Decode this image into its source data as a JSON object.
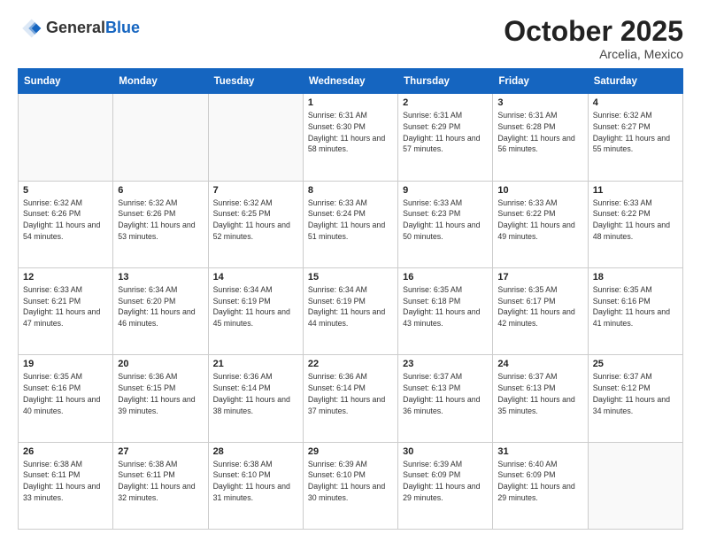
{
  "header": {
    "logo_general": "General",
    "logo_blue": "Blue",
    "month": "October 2025",
    "location": "Arcelia, Mexico"
  },
  "days_of_week": [
    "Sunday",
    "Monday",
    "Tuesday",
    "Wednesday",
    "Thursday",
    "Friday",
    "Saturday"
  ],
  "weeks": [
    [
      {
        "day": "",
        "sunrise": "",
        "sunset": "",
        "daylight": "",
        "empty": true
      },
      {
        "day": "",
        "sunrise": "",
        "sunset": "",
        "daylight": "",
        "empty": true
      },
      {
        "day": "",
        "sunrise": "",
        "sunset": "",
        "daylight": "",
        "empty": true
      },
      {
        "day": "1",
        "sunrise": "Sunrise: 6:31 AM",
        "sunset": "Sunset: 6:30 PM",
        "daylight": "Daylight: 11 hours and 58 minutes."
      },
      {
        "day": "2",
        "sunrise": "Sunrise: 6:31 AM",
        "sunset": "Sunset: 6:29 PM",
        "daylight": "Daylight: 11 hours and 57 minutes."
      },
      {
        "day": "3",
        "sunrise": "Sunrise: 6:31 AM",
        "sunset": "Sunset: 6:28 PM",
        "daylight": "Daylight: 11 hours and 56 minutes."
      },
      {
        "day": "4",
        "sunrise": "Sunrise: 6:32 AM",
        "sunset": "Sunset: 6:27 PM",
        "daylight": "Daylight: 11 hours and 55 minutes."
      }
    ],
    [
      {
        "day": "5",
        "sunrise": "Sunrise: 6:32 AM",
        "sunset": "Sunset: 6:26 PM",
        "daylight": "Daylight: 11 hours and 54 minutes."
      },
      {
        "day": "6",
        "sunrise": "Sunrise: 6:32 AM",
        "sunset": "Sunset: 6:26 PM",
        "daylight": "Daylight: 11 hours and 53 minutes."
      },
      {
        "day": "7",
        "sunrise": "Sunrise: 6:32 AM",
        "sunset": "Sunset: 6:25 PM",
        "daylight": "Daylight: 11 hours and 52 minutes."
      },
      {
        "day": "8",
        "sunrise": "Sunrise: 6:33 AM",
        "sunset": "Sunset: 6:24 PM",
        "daylight": "Daylight: 11 hours and 51 minutes."
      },
      {
        "day": "9",
        "sunrise": "Sunrise: 6:33 AM",
        "sunset": "Sunset: 6:23 PM",
        "daylight": "Daylight: 11 hours and 50 minutes."
      },
      {
        "day": "10",
        "sunrise": "Sunrise: 6:33 AM",
        "sunset": "Sunset: 6:22 PM",
        "daylight": "Daylight: 11 hours and 49 minutes."
      },
      {
        "day": "11",
        "sunrise": "Sunrise: 6:33 AM",
        "sunset": "Sunset: 6:22 PM",
        "daylight": "Daylight: 11 hours and 48 minutes."
      }
    ],
    [
      {
        "day": "12",
        "sunrise": "Sunrise: 6:33 AM",
        "sunset": "Sunset: 6:21 PM",
        "daylight": "Daylight: 11 hours and 47 minutes."
      },
      {
        "day": "13",
        "sunrise": "Sunrise: 6:34 AM",
        "sunset": "Sunset: 6:20 PM",
        "daylight": "Daylight: 11 hours and 46 minutes."
      },
      {
        "day": "14",
        "sunrise": "Sunrise: 6:34 AM",
        "sunset": "Sunset: 6:19 PM",
        "daylight": "Daylight: 11 hours and 45 minutes."
      },
      {
        "day": "15",
        "sunrise": "Sunrise: 6:34 AM",
        "sunset": "Sunset: 6:19 PM",
        "daylight": "Daylight: 11 hours and 44 minutes."
      },
      {
        "day": "16",
        "sunrise": "Sunrise: 6:35 AM",
        "sunset": "Sunset: 6:18 PM",
        "daylight": "Daylight: 11 hours and 43 minutes."
      },
      {
        "day": "17",
        "sunrise": "Sunrise: 6:35 AM",
        "sunset": "Sunset: 6:17 PM",
        "daylight": "Daylight: 11 hours and 42 minutes."
      },
      {
        "day": "18",
        "sunrise": "Sunrise: 6:35 AM",
        "sunset": "Sunset: 6:16 PM",
        "daylight": "Daylight: 11 hours and 41 minutes."
      }
    ],
    [
      {
        "day": "19",
        "sunrise": "Sunrise: 6:35 AM",
        "sunset": "Sunset: 6:16 PM",
        "daylight": "Daylight: 11 hours and 40 minutes."
      },
      {
        "day": "20",
        "sunrise": "Sunrise: 6:36 AM",
        "sunset": "Sunset: 6:15 PM",
        "daylight": "Daylight: 11 hours and 39 minutes."
      },
      {
        "day": "21",
        "sunrise": "Sunrise: 6:36 AM",
        "sunset": "Sunset: 6:14 PM",
        "daylight": "Daylight: 11 hours and 38 minutes."
      },
      {
        "day": "22",
        "sunrise": "Sunrise: 6:36 AM",
        "sunset": "Sunset: 6:14 PM",
        "daylight": "Daylight: 11 hours and 37 minutes."
      },
      {
        "day": "23",
        "sunrise": "Sunrise: 6:37 AM",
        "sunset": "Sunset: 6:13 PM",
        "daylight": "Daylight: 11 hours and 36 minutes."
      },
      {
        "day": "24",
        "sunrise": "Sunrise: 6:37 AM",
        "sunset": "Sunset: 6:13 PM",
        "daylight": "Daylight: 11 hours and 35 minutes."
      },
      {
        "day": "25",
        "sunrise": "Sunrise: 6:37 AM",
        "sunset": "Sunset: 6:12 PM",
        "daylight": "Daylight: 11 hours and 34 minutes."
      }
    ],
    [
      {
        "day": "26",
        "sunrise": "Sunrise: 6:38 AM",
        "sunset": "Sunset: 6:11 PM",
        "daylight": "Daylight: 11 hours and 33 minutes."
      },
      {
        "day": "27",
        "sunrise": "Sunrise: 6:38 AM",
        "sunset": "Sunset: 6:11 PM",
        "daylight": "Daylight: 11 hours and 32 minutes."
      },
      {
        "day": "28",
        "sunrise": "Sunrise: 6:38 AM",
        "sunset": "Sunset: 6:10 PM",
        "daylight": "Daylight: 11 hours and 31 minutes."
      },
      {
        "day": "29",
        "sunrise": "Sunrise: 6:39 AM",
        "sunset": "Sunset: 6:10 PM",
        "daylight": "Daylight: 11 hours and 30 minutes."
      },
      {
        "day": "30",
        "sunrise": "Sunrise: 6:39 AM",
        "sunset": "Sunset: 6:09 PM",
        "daylight": "Daylight: 11 hours and 29 minutes."
      },
      {
        "day": "31",
        "sunrise": "Sunrise: 6:40 AM",
        "sunset": "Sunset: 6:09 PM",
        "daylight": "Daylight: 11 hours and 29 minutes."
      },
      {
        "day": "",
        "sunrise": "",
        "sunset": "",
        "daylight": "",
        "empty": true
      }
    ]
  ]
}
